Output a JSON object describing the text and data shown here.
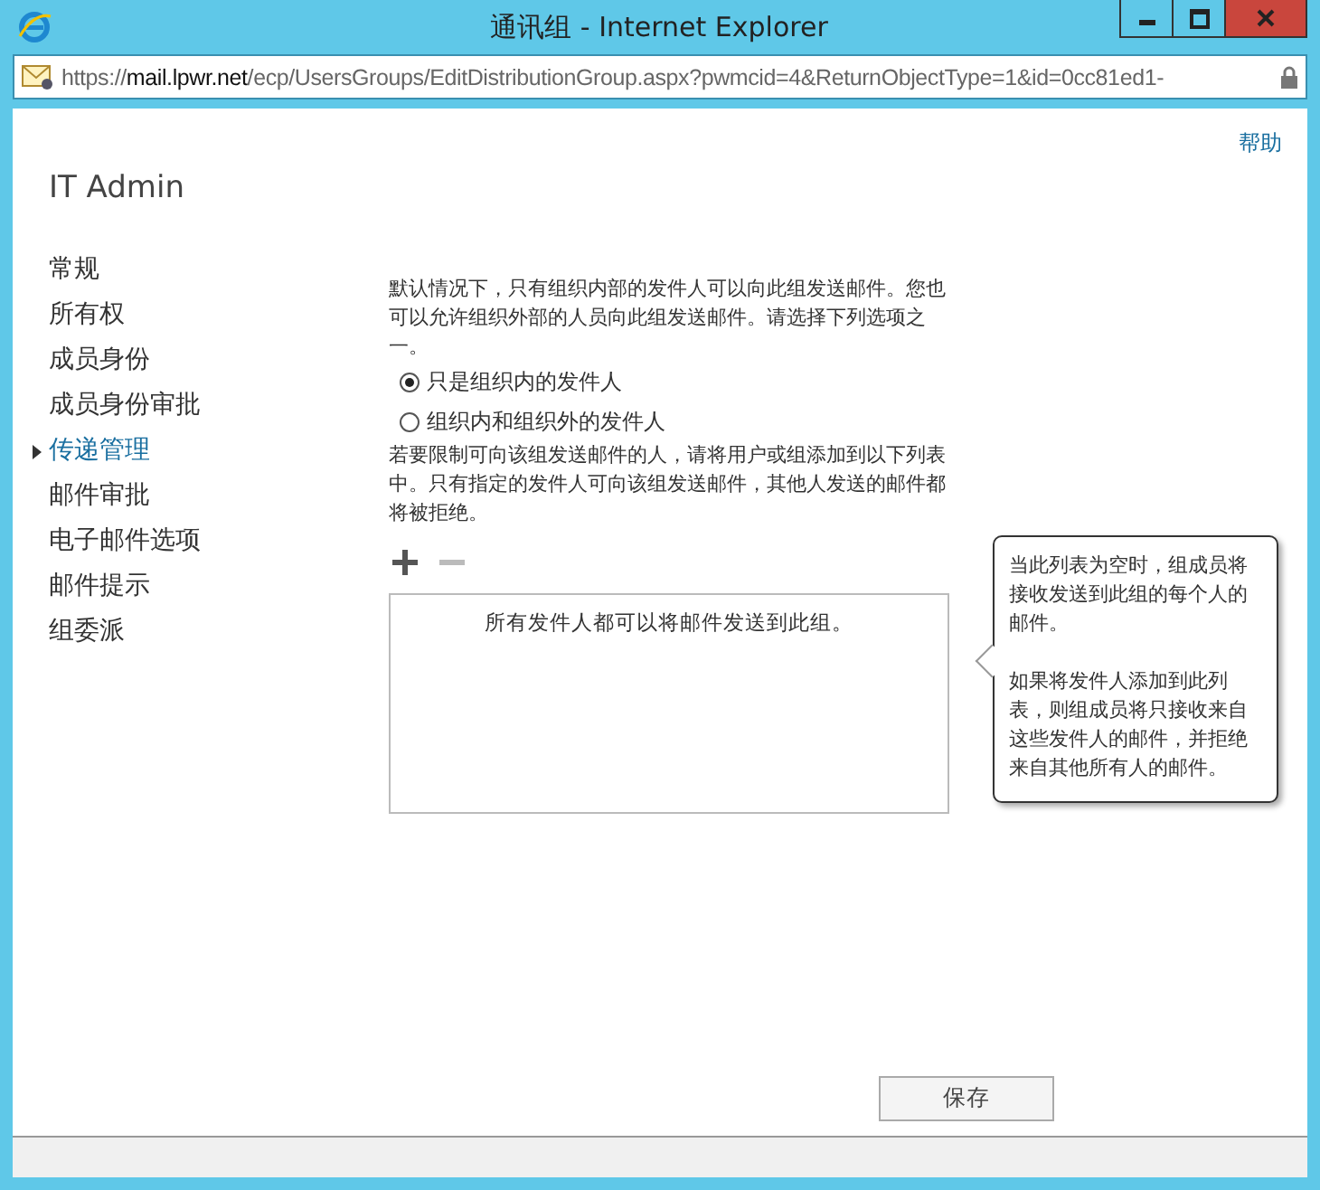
{
  "window": {
    "title": "通讯组 - Internet Explorer"
  },
  "address_bar": {
    "url_scheme": "https://",
    "url_host": "mail.lpwr.net",
    "url_path": "/ecp/UsersGroups/EditDistributionGroup.aspx?pwmcid=4&ReturnObjectType=1&id=0cc81ed1-"
  },
  "help_link": "帮助",
  "group_name": "IT Admin",
  "sidebar": {
    "items": [
      {
        "label": "常规",
        "selected": false
      },
      {
        "label": "所有权",
        "selected": false
      },
      {
        "label": "成员身份",
        "selected": false
      },
      {
        "label": "成员身份审批",
        "selected": false
      },
      {
        "label": "传递管理",
        "selected": true
      },
      {
        "label": "邮件审批",
        "selected": false
      },
      {
        "label": "电子邮件选项",
        "selected": false
      },
      {
        "label": "邮件提示",
        "selected": false
      },
      {
        "label": "组委派",
        "selected": false
      }
    ]
  },
  "intro": "默认情况下，只有组织内部的发件人可以向此组发送邮件。您也可以允许组织外部的人员向此组发送邮件。请选择下列选项之一。",
  "options": [
    {
      "label": "只是组织内的发件人",
      "selected": true
    },
    {
      "label": "组织内和组织外的发件人",
      "selected": false
    }
  ],
  "restrict_text": "若要限制可向该组发送邮件的人，请将用户或组添加到以下列表中。只有指定的发件人可向该组发送邮件，其他人发送的邮件都将被拒绝。",
  "list": {
    "empty_text": "所有发件人都可以将邮件发送到此组。",
    "remove_disabled": true
  },
  "tooltip": {
    "paragraphs": [
      "当此列表为空时，组成员将接收发送到此组的每个人的邮件。",
      "如果将发件人添加到此列表，则组成员将只接收来自这些发件人的邮件，并拒绝来自其他所有人的邮件。"
    ]
  },
  "buttons": [
    "保存"
  ]
}
